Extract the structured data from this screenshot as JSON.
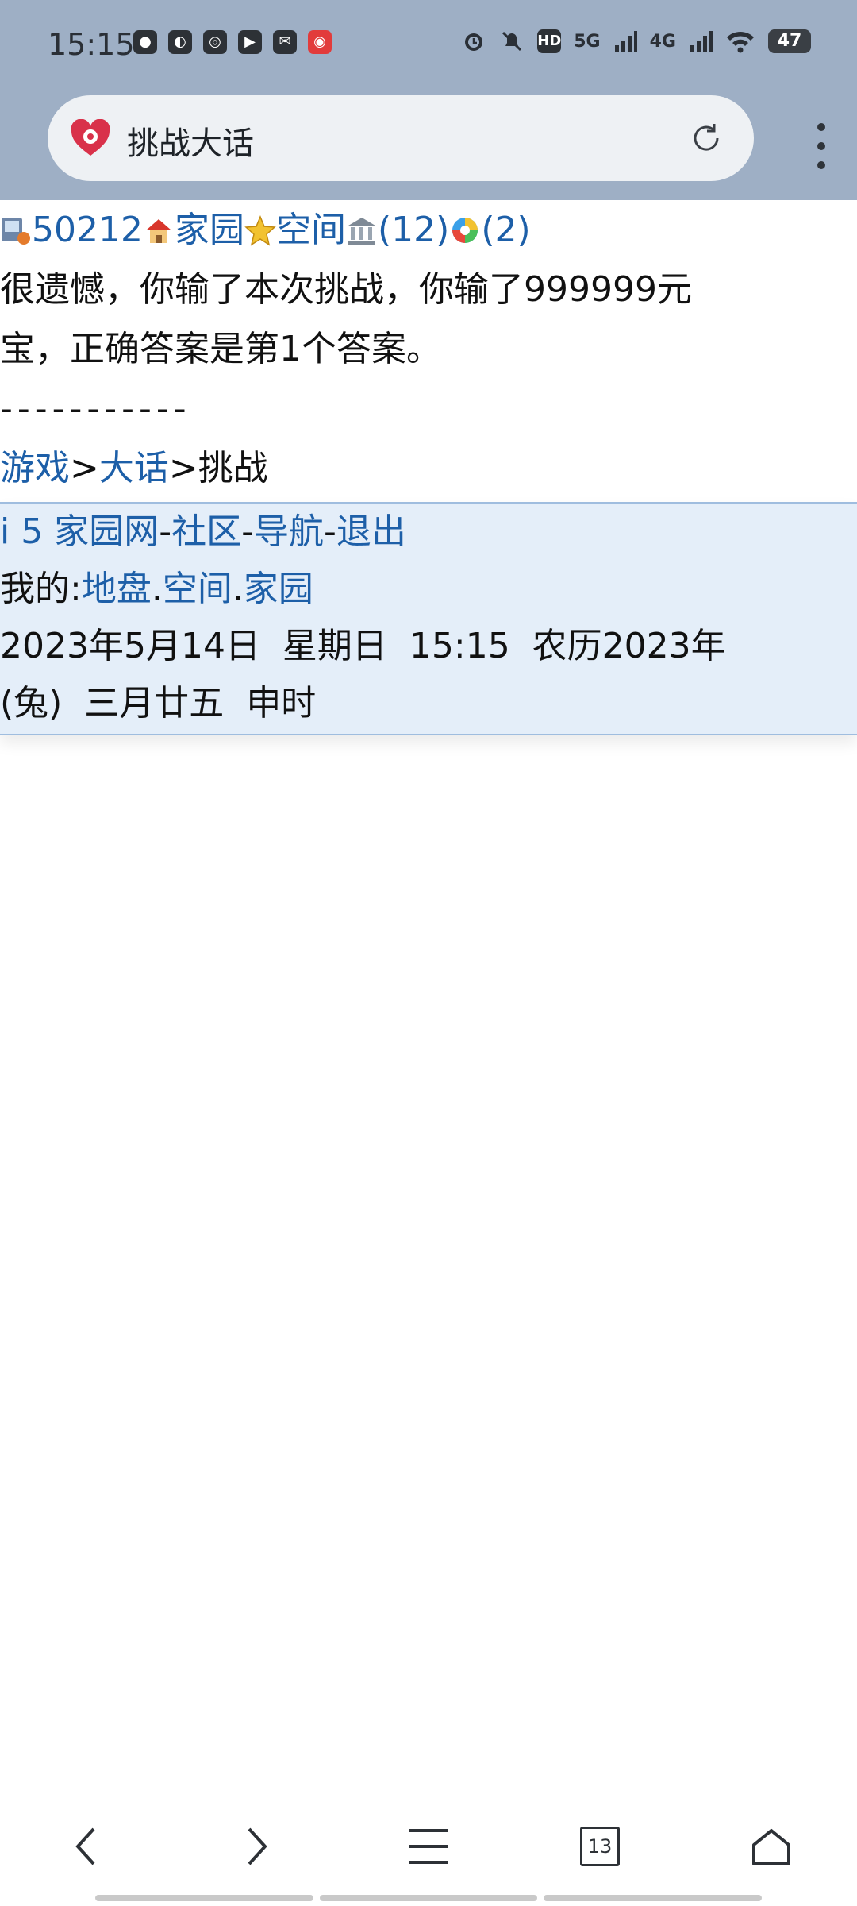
{
  "status_bar": {
    "time": "15:15",
    "hd_label": "HD",
    "net1": "5G",
    "net2": "4G",
    "battery": "47"
  },
  "browser": {
    "page_title": "挑战大话",
    "tab_count": "13"
  },
  "topline": {
    "id_link": "50212",
    "home_link": "家园",
    "space_link": "空间",
    "count1": "(12)",
    "count2": "(2)"
  },
  "result": {
    "line1": "很遗憾，你输了本次挑战，你输了999999元",
    "line2": "宝，正确答案是第1个答案。"
  },
  "divider": "-----------",
  "breadcrumb": {
    "games": "游戏",
    "sep": ">",
    "dahua": "大话",
    "current": "挑战"
  },
  "footer": {
    "site": "i 5 家园网",
    "sep": "-",
    "community": "社区",
    "nav": "导航",
    "logout": "退出",
    "my_label": "我的:",
    "dipan": "地盘",
    "dot": ".",
    "space": "空间",
    "home": "家园",
    "date_line1": "2023年5月14日  星期日  15:15  农历2023年",
    "date_line2": "(兔)  三月廿五  申时"
  }
}
